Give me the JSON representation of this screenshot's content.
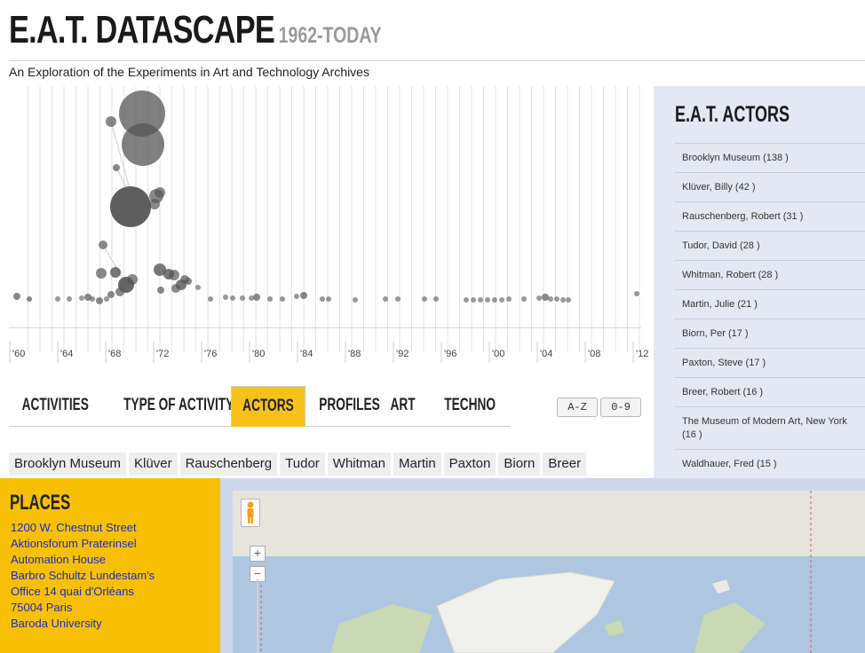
{
  "header": {
    "title": "E.A.T. DATASCAPE",
    "title_years": "1962-TODAY",
    "subtitle": "An Exploration of the Experiments in Art and Technology Archives"
  },
  "timeline": {
    "tick_labels": [
      "'60",
      "'64",
      "'68",
      "'72",
      "'76",
      "'80",
      "'84",
      "'88",
      "'92",
      "'96",
      "'00",
      "'04",
      "'08",
      "'12"
    ],
    "bubble_color": "#555555"
  },
  "tabs": [
    {
      "label": "ACTIVITIES",
      "active": false
    },
    {
      "label": "TYPE OF ACTIVITY",
      "active": false
    },
    {
      "label": "ACTORS",
      "active": true
    },
    {
      "label": "PROFILES",
      "active": false
    },
    {
      "label": "ART",
      "active": false
    },
    {
      "label": "TECHNO",
      "active": false
    }
  ],
  "sort_buttons": {
    "alpha": "A-Z",
    "numeric": "0-9"
  },
  "actor_chips": [
    "Brooklyn Museum",
    "Klüver",
    "Rauschenberg",
    "Tudor",
    "Whitman",
    "Martin",
    "Paxton",
    "Biorn",
    "Breer"
  ],
  "actors_panel": {
    "title": "E.A.T. ACTORS",
    "items": [
      "Brooklyn Museum (138 )",
      "Klüver, Billy (42 )",
      "Rauschenberg, Robert (31 )",
      "Tudor, David (28 )",
      "Whitman, Robert (28 )",
      "Martin, Julie (21 )",
      "Biorn, Per (17 )",
      "Paxton, Steve (17 )",
      "Breer, Robert (16 )",
      "The Museum of Modern Art, New York (16 )",
      "Waldhauer, Fred (15 )"
    ]
  },
  "places": {
    "title": "PLACES",
    "items": [
      "1200 W. Chestnut Street",
      "Aktionsforum Praterinsel",
      "Automation House",
      "Barbro Schultz Lundestam's",
      "Office 14 quai d'Orléans",
      "75004 Paris",
      "Baroda University"
    ]
  },
  "map": {
    "zoom_in": "+",
    "zoom_out": "−"
  },
  "colors": {
    "accent_yellow": "#f6c21a",
    "places_bg": "#f8c004",
    "panel_bg": "#e4e8f4",
    "link": "#1a2bbf"
  }
}
